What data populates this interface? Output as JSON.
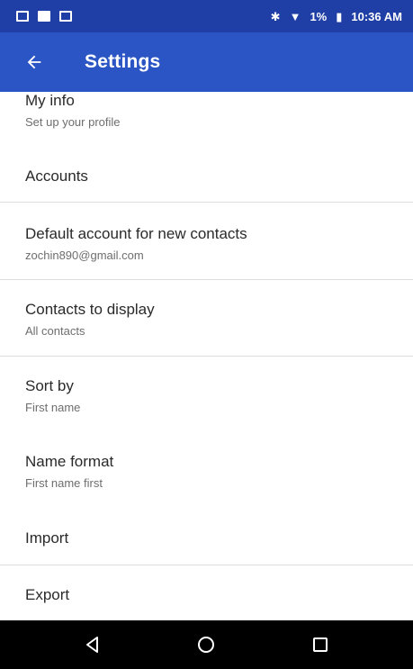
{
  "status_bar": {
    "battery": "1%",
    "time": "10:36 AM",
    "icons": [
      "photo-icon",
      "b-icon",
      "image-icon",
      "bluetooth-icon",
      "wifi-icon",
      "battery-icon"
    ]
  },
  "app_bar": {
    "title": "Settings",
    "back_icon": "arrow-left-icon"
  },
  "settings": {
    "my_info": {
      "title": "My info",
      "subtitle": "Set up your profile"
    },
    "accounts": {
      "title": "Accounts"
    },
    "default_account": {
      "title": "Default account for new contacts",
      "subtitle": "zochin890@gmail.com"
    },
    "contacts_to_display": {
      "title": "Contacts to display",
      "subtitle": "All contacts"
    },
    "sort_by": {
      "title": "Sort by",
      "subtitle": "First name"
    },
    "name_format": {
      "title": "Name format",
      "subtitle": "First name first"
    },
    "import": {
      "title": "Import"
    },
    "export": {
      "title": "Export"
    }
  },
  "nav_bar": {
    "icons": [
      "back-triangle-icon",
      "home-circle-icon",
      "recents-square-icon"
    ]
  },
  "colors": {
    "status_bar": "#1f3ea6",
    "app_bar": "#2b54c4",
    "divider": "#dddddd",
    "nav_bar": "#000000"
  }
}
